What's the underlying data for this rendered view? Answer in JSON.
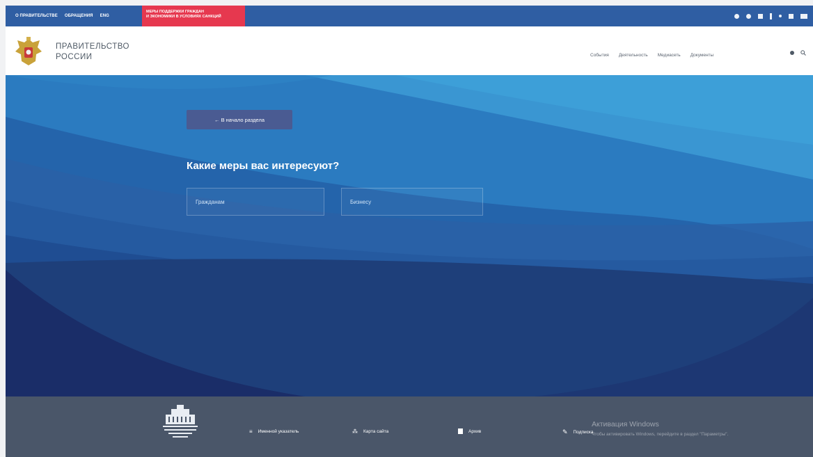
{
  "topbar": {
    "links": [
      "О ПРАВИТЕЛЬСТВЕ",
      "ОБРАЩЕНИЯ",
      "ENG"
    ],
    "promo_line1": "МЕРЫ ПОДДЕРЖКИ ГРАЖДАН",
    "promo_line2": "И ЭКОНОМИКИ В УСЛОВИЯХ САНКЦИЙ",
    "social_icons": [
      "vk-icon",
      "ok-icon",
      "telegram-icon",
      "rss-icon",
      "youtube-icon",
      "accessibility-icon",
      "user-icon"
    ]
  },
  "header": {
    "brand_line1": "ПРАВИТЕЛЬСТВО",
    "brand_line2": "РОССИИ",
    "nav": [
      "События",
      "Деятельность",
      "Медиасеть",
      "Документы"
    ]
  },
  "hero": {
    "back_button": "← В начало раздела",
    "heading": "Какие меры вас интересуют?",
    "input_citizens": "Гражданам",
    "input_business": "Бизнесу"
  },
  "footer": {
    "items": [
      "Именной указатель",
      "Карта сайта",
      "Архив",
      "Подписка"
    ],
    "activate_title": "Активация Windows",
    "activate_hint": "Чтобы активировать Windows, перейдите в раздел \"Параметры\"."
  },
  "colors": {
    "topbar": "#2f5ea3",
    "promo": "#e6384f",
    "hero_dark": "#1e3f7a",
    "footer": "#4a5669"
  }
}
